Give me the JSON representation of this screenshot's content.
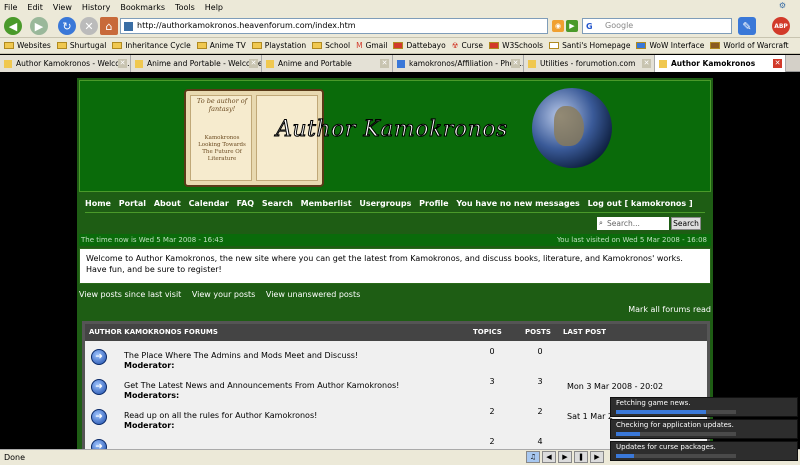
{
  "browser": {
    "menu": [
      "File",
      "Edit",
      "View",
      "History",
      "Bookmarks",
      "Tools",
      "Help"
    ],
    "url": "http://authorkamokronos.heavenforum.com/index.htm",
    "search_placeholder": "Google",
    "addon_badge": "ABP",
    "bookmarks": [
      "Websites",
      "Shurtugal",
      "Inheritance Cycle",
      "Anime TV",
      "Playstation",
      "School",
      "Gmail",
      "Dattebayo",
      "Curse",
      "W3Schools",
      "Santi's Homepage",
      "WoW Interface",
      "World of Warcraft"
    ],
    "tabs": [
      {
        "label": "Author Kamokronos - Welcom...",
        "active": false
      },
      {
        "label": "Anime and Portable - Welcome...",
        "active": false
      },
      {
        "label": "Anime and Portable",
        "active": false
      },
      {
        "label": "kamokronos/Affiliation - Phot...",
        "active": false
      },
      {
        "label": "Utilities - forumotion.com",
        "active": false
      },
      {
        "label": "Author Kamokronos",
        "active": true
      }
    ],
    "status": "Done"
  },
  "site": {
    "title": "Author Kamokronos",
    "book_text_top": "To be author of fantasy!",
    "book_text_bottom": "Kamokronos Looking Towards The Future Of Literature",
    "nav": [
      "Home",
      "Portal",
      "About",
      "Calendar",
      "FAQ",
      "Search",
      "Memberlist",
      "Usergroups",
      "Profile",
      "You have no new messages",
      "Log out [ kamokronos ]"
    ],
    "search_placeholder": "Search...",
    "search_button": "Search",
    "time_now": "The time now is Wed 5 Mar 2008 - 16:43",
    "last_visit": "You last visited on Wed 5 Mar 2008 - 16:08",
    "welcome": "Welcome to Author Kamokronos, the new site where you can get the latest from Kamokronos, and discuss books, literature, and Kamokronos' works. Have fun, and be sure to register!",
    "links": [
      "View posts since last visit",
      "View your posts",
      "View unanswered posts"
    ],
    "mark_all": "Mark all forums read"
  },
  "forums": {
    "headers": {
      "name": "AUTHOR KAMOKRONOS FORUMS",
      "topics": "TOPICS",
      "posts": "POSTS",
      "last": "LAST POST"
    },
    "rows": [
      {
        "title": "The Place Where The Admins and Mods Meet and Discuss!",
        "mods": "Moderator:",
        "topics": "0",
        "posts": "0",
        "last": ""
      },
      {
        "title": "Get The Latest News and Announcements From Author Kamokronos!",
        "mods": "Moderators:",
        "topics": "3",
        "posts": "3",
        "last": "Mon 3 Mar 2008 - 20:02"
      },
      {
        "title": "Read up on all the rules for Author Kamokronos!",
        "mods": "Moderator:",
        "topics": "2",
        "posts": "2",
        "last": "Sat 1 Mar 2"
      },
      {
        "title": "",
        "mods": "",
        "topics": "2",
        "posts": "4",
        "last": ""
      }
    ]
  },
  "notifications": [
    {
      "text": "Fetching game news.",
      "progress": 0.75
    },
    {
      "text": "Checking for application updates.",
      "progress": 0.2
    },
    {
      "text": "Updates for curse packages.",
      "progress": 0.15
    }
  ]
}
